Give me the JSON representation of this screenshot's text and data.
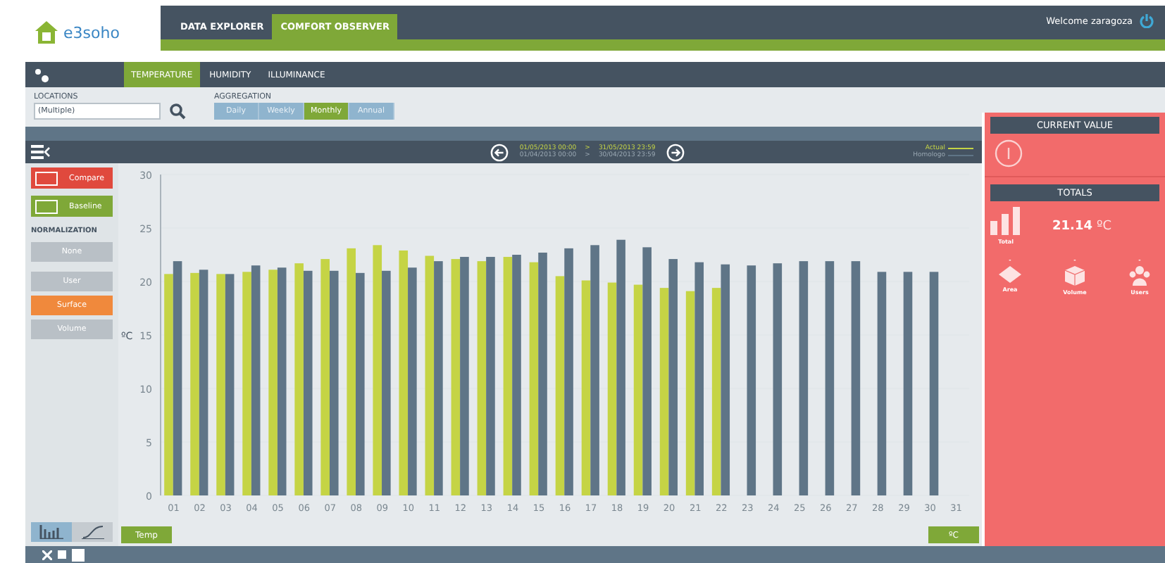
{
  "header": {
    "logo": "e3soho",
    "nav": [
      {
        "label": "DATA EXPLORER",
        "selected": false
      },
      {
        "label": "COMFORT OBSERVER",
        "selected": true
      }
    ],
    "welcome": "Welcome zaragoza"
  },
  "tabs": [
    {
      "label": "TEMPERATURE",
      "selected": true
    },
    {
      "label": "HUMIDITY",
      "selected": false
    },
    {
      "label": "ILLUMINANCE",
      "selected": false
    }
  ],
  "filters": {
    "locations_label": "LOCATIONS",
    "locations_value": "(Multiple)",
    "aggregation_label": "AGGREGATION",
    "aggregation": [
      {
        "label": "Daily",
        "selected": false
      },
      {
        "label": "Weekly",
        "selected": false
      },
      {
        "label": "Monthly",
        "selected": true
      },
      {
        "label": "Annual",
        "selected": false
      }
    ]
  },
  "period": {
    "actual_start": "01/05/2013 00:00",
    "actual_end": "31/05/2013 23:59",
    "previous_start": "01/04/2013 00:00",
    "previous_end": "30/04/2013 23:59",
    "separator": ">"
  },
  "sidebar": {
    "compare": "Compare",
    "baseline": "Baseline",
    "normalization_label": "NORMALIZATION",
    "normalization": [
      {
        "label": "None",
        "selected": false
      },
      {
        "label": "User",
        "selected": false
      },
      {
        "label": "Surface",
        "selected": true
      },
      {
        "label": "Volume",
        "selected": false
      }
    ],
    "chart_types": [
      {
        "kind": "bar",
        "selected": true
      },
      {
        "kind": "line",
        "selected": false
      }
    ]
  },
  "chart": {
    "chart_data": {
      "type": "bar",
      "ylabel": "ºC",
      "categories": [
        "01",
        "02",
        "03",
        "04",
        "05",
        "06",
        "07",
        "08",
        "09",
        "10",
        "11",
        "12",
        "13",
        "14",
        "15",
        "16",
        "17",
        "18",
        "19",
        "20",
        "21",
        "22",
        "23",
        "24",
        "25",
        "26",
        "27",
        "28",
        "29",
        "30",
        "31"
      ],
      "ylim": [
        0,
        30
      ],
      "yticks": [
        0,
        5,
        10,
        15,
        20,
        25,
        30
      ],
      "series": [
        {
          "name": "Actual",
          "color": "#c5d445",
          "values": [
            20.7,
            20.8,
            20.7,
            20.9,
            21.1,
            21.7,
            22.1,
            23.1,
            23.4,
            22.9,
            22.4,
            22.1,
            21.9,
            22.3,
            21.8,
            20.5,
            20.1,
            19.9,
            19.7,
            19.4,
            19.1,
            19.4,
            null,
            null,
            null,
            null,
            null,
            null,
            null,
            null,
            null
          ]
        },
        {
          "name": "Homologo",
          "color": "#5f7587",
          "values": [
            21.9,
            21.1,
            20.7,
            21.5,
            21.3,
            21.0,
            21.0,
            20.8,
            21.0,
            21.3,
            21.9,
            22.3,
            22.3,
            22.5,
            22.7,
            23.1,
            23.4,
            23.9,
            23.2,
            22.1,
            21.8,
            21.6,
            21.5,
            21.7,
            21.9,
            21.9,
            21.9,
            20.9,
            20.9,
            20.9,
            null
          ]
        }
      ]
    },
    "series_button": "Temp",
    "unit_button": "ºC"
  },
  "right_panel": {
    "current_value_title": "CURRENT VALUE",
    "totals_title": "TOTALS",
    "total_label": "Total",
    "total_value": "21.14",
    "total_unit": "ºC",
    "metrics": [
      {
        "kind": "area",
        "value": "-",
        "label": "Area"
      },
      {
        "kind": "volume",
        "value": "-",
        "label": "Volume"
      },
      {
        "kind": "users",
        "value": "-",
        "label": "Users"
      }
    ]
  }
}
